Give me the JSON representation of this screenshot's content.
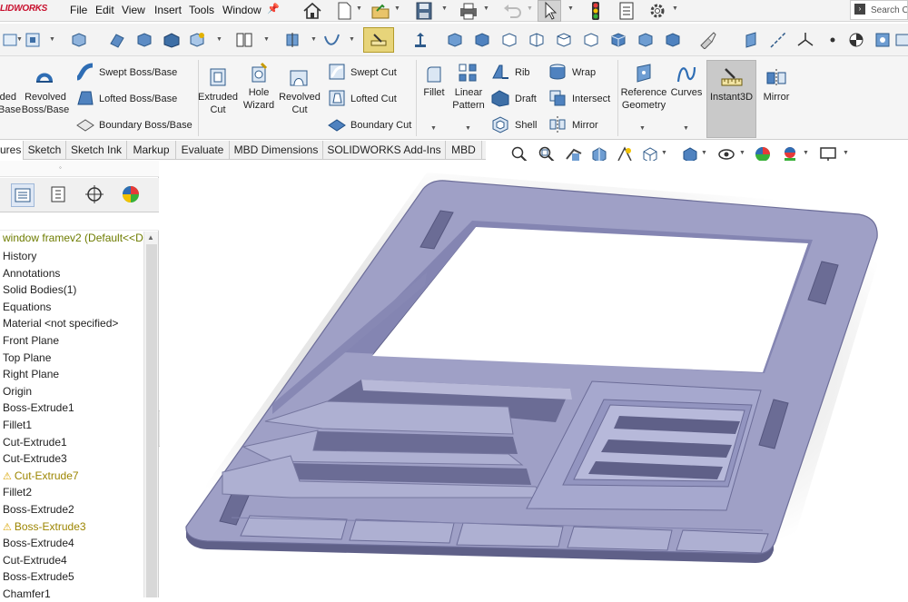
{
  "app": {
    "logo_text": "LIDWORKS"
  },
  "menu": [
    "File",
    "Edit",
    "View",
    "Insert",
    "Tools",
    "Window"
  ],
  "search": {
    "placeholder": "Search C"
  },
  "ribbon": {
    "extrude_partial": "ded\nBase",
    "revolved_boss": "Revolved\nBoss/Base",
    "swept_boss": "Swept Boss/Base",
    "lofted_boss": "Lofted Boss/Base",
    "boundary_boss": "Boundary Boss/Base",
    "extruded_cut": "Extruded\nCut",
    "hole_wizard": "Hole\nWizard",
    "revolved_cut": "Revolved\nCut",
    "swept_cut": "Swept Cut",
    "lofted_cut": "Lofted Cut",
    "boundary_cut": "Boundary Cut",
    "fillet": "Fillet",
    "linear_pattern": "Linear\nPattern",
    "rib": "Rib",
    "draft": "Draft",
    "shell": "Shell",
    "wrap": "Wrap",
    "intersect": "Intersect",
    "mirror_small": "Mirror",
    "reference_geometry": "Reference\nGeometry",
    "curves": "Curves",
    "instant3d": "Instant3D",
    "mirror": "Mirror"
  },
  "tabs": [
    {
      "label": "ures",
      "active": true
    },
    {
      "label": "Sketch",
      "active": false
    },
    {
      "label": "Sketch Ink",
      "active": false
    },
    {
      "label": "Markup",
      "active": false
    },
    {
      "label": "Evaluate",
      "active": false
    },
    {
      "label": "MBD Dimensions",
      "active": false
    },
    {
      "label": "SOLIDWORKS Add-Ins",
      "active": false
    },
    {
      "label": "MBD",
      "active": false
    }
  ],
  "feature_tree": {
    "root": "window framev2  (Default<<D",
    "items": [
      {
        "label": "History",
        "warning": false
      },
      {
        "label": "Annotations",
        "warning": false
      },
      {
        "label": "Solid Bodies(1)",
        "warning": false
      },
      {
        "label": "Equations",
        "warning": false
      },
      {
        "label": "Material <not specified>",
        "warning": false
      },
      {
        "label": "Front Plane",
        "warning": false
      },
      {
        "label": "Top Plane",
        "warning": false
      },
      {
        "label": "Right Plane",
        "warning": false
      },
      {
        "label": "Origin",
        "warning": false
      },
      {
        "label": "Boss-Extrude1",
        "warning": false
      },
      {
        "label": "Fillet1",
        "warning": false
      },
      {
        "label": "Cut-Extrude1",
        "warning": false
      },
      {
        "label": "Cut-Extrude3",
        "warning": false
      },
      {
        "label": "Cut-Extrude7",
        "warning": true
      },
      {
        "label": "Fillet2",
        "warning": false
      },
      {
        "label": "Boss-Extrude2",
        "warning": false
      },
      {
        "label": "Boss-Extrude3",
        "warning": true
      },
      {
        "label": "Boss-Extrude4",
        "warning": false
      },
      {
        "label": "Cut-Extrude4",
        "warning": false
      },
      {
        "label": "Boss-Extrude5",
        "warning": false
      },
      {
        "label": "Chamfer1",
        "warning": false
      }
    ]
  },
  "colors": {
    "model_top": "#9fa0c6",
    "model_side": "#7a7ba8",
    "model_dark": "#5f6088",
    "accent_red": "#c8102e",
    "tree_root": "#6e7c00",
    "warning": "#d9a400"
  }
}
